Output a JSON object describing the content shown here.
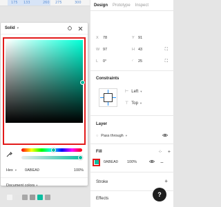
{
  "ruler": {
    "ticks": [
      "175",
      "133",
      "260",
      "275",
      "300"
    ]
  },
  "picker": {
    "mode": "Solid",
    "format": "Hex",
    "hex": "0ABEA0",
    "opacity": "100%",
    "doc_colors_label": "Document colors",
    "doc_colors": [
      "#f4f4f4",
      "#e4e4e4",
      "#a8a8a8",
      "#9a9a9a",
      "#0abea0",
      "#a7a7a7"
    ]
  },
  "tabs": [
    "Design",
    "Prototype",
    "Inspect"
  ],
  "props": {
    "x_label": "X",
    "x": "78",
    "y_label": "Y",
    "y": "91",
    "w_label": "W",
    "w": "97",
    "h_label": "H",
    "h": "43",
    "r_label": "L",
    "rotation": "0°",
    "corner": "25"
  },
  "constraints": {
    "title": "Constraints",
    "horizontal": "Left",
    "vertical": "Top"
  },
  "layer": {
    "title": "Layer",
    "blend": "Pass through"
  },
  "fill": {
    "title": "Fill",
    "hex": "0ABEA0",
    "opacity": "100%",
    "color": "#0abea0"
  },
  "stroke": {
    "title": "Stroke"
  },
  "effects": {
    "title": "Effects"
  },
  "help": {
    "label": "?"
  }
}
